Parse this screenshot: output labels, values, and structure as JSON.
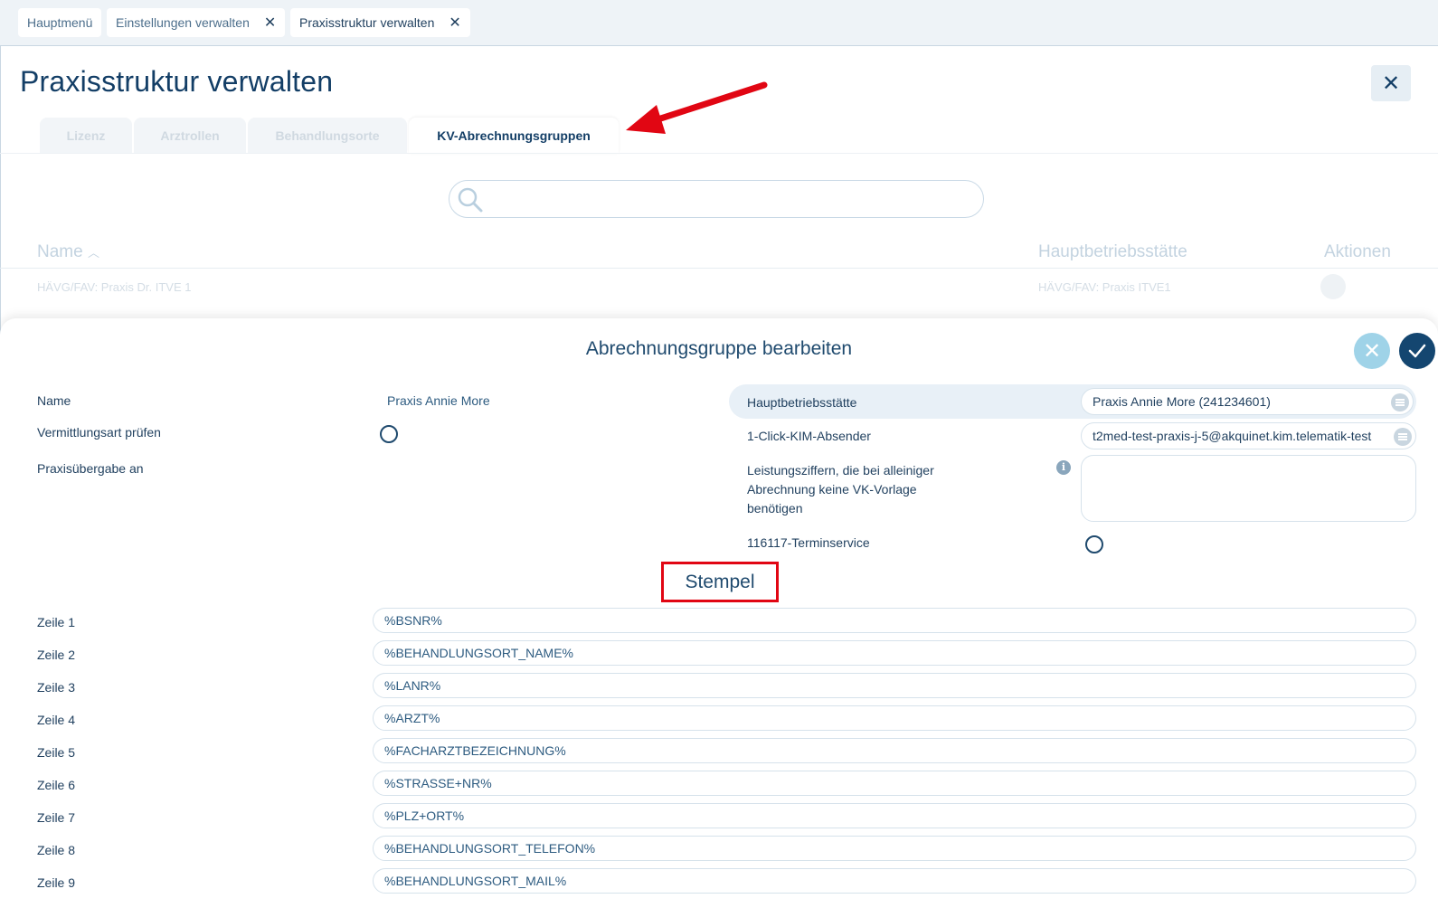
{
  "top_tabs": [
    {
      "label": "Hauptmenü"
    },
    {
      "label": "Einstellungen verwalten"
    },
    {
      "label": "Praxisstruktur verwalten"
    }
  ],
  "page_title": "Praxisstruktur verwalten",
  "sub_tabs": [
    "Lizenz",
    "Arztrollen",
    "Behandlungsorte",
    "KV-Abrechnungsgruppen"
  ],
  "search": {
    "placeholder": ""
  },
  "list": {
    "columns": [
      "Name",
      "Hauptbetriebsstätte",
      "Aktionen"
    ],
    "rows": [
      {
        "name": "HÄVG/FAV: Praxis Dr. ITVE 1",
        "hbs": "HÄVG/FAV: Praxis ITVE1"
      }
    ]
  },
  "edit_panel": {
    "title": "Abrechnungsgruppe bearbeiten",
    "left": {
      "name_label": "Name",
      "name_value": "Praxis Annie More",
      "vermittlung_label": "Vermittlungsart prüfen",
      "uebergabe_label": "Praxisübergabe an"
    },
    "right": {
      "hbs_label": "Hauptbetriebsstätte",
      "hbs_value": "Praxis Annie More (241234601)",
      "kim_label": "1-Click-KIM-Absender",
      "kim_value": "t2med-test-praxis-j-5@akquinet.kim.telematik-test",
      "leistung_label_1": "Leistungsziffern, die bei alleiniger",
      "leistung_label_2": "Abrechnung keine VK-Vorlage",
      "leistung_label_3": "benötigen",
      "termin_label": "116117-Terminservice"
    },
    "stempel_title": "Stempel",
    "stempel_lines": [
      {
        "label": "Zeile 1",
        "value": "%BSNR%"
      },
      {
        "label": "Zeile 2",
        "value": "%BEHANDLUNGSORT_NAME%"
      },
      {
        "label": "Zeile 3",
        "value": "%LANR%"
      },
      {
        "label": "Zeile 4",
        "value": "%ARZT%"
      },
      {
        "label": "Zeile 5",
        "value": "%FACHARZTBEZEICHNUNG%"
      },
      {
        "label": "Zeile 6",
        "value": "%STRASSE+NR%"
      },
      {
        "label": "Zeile 7",
        "value": "%PLZ+ORT%"
      },
      {
        "label": "Zeile 8",
        "value": "%BEHANDLUNGSORT_TELEFON%"
      },
      {
        "label": "Zeile 9",
        "value": "%BEHANDLUNGSORT_MAIL%"
      }
    ]
  },
  "colors": {
    "primary": "#133e66",
    "accent_red": "#e10613",
    "light_blue": "#9fd3e8"
  }
}
